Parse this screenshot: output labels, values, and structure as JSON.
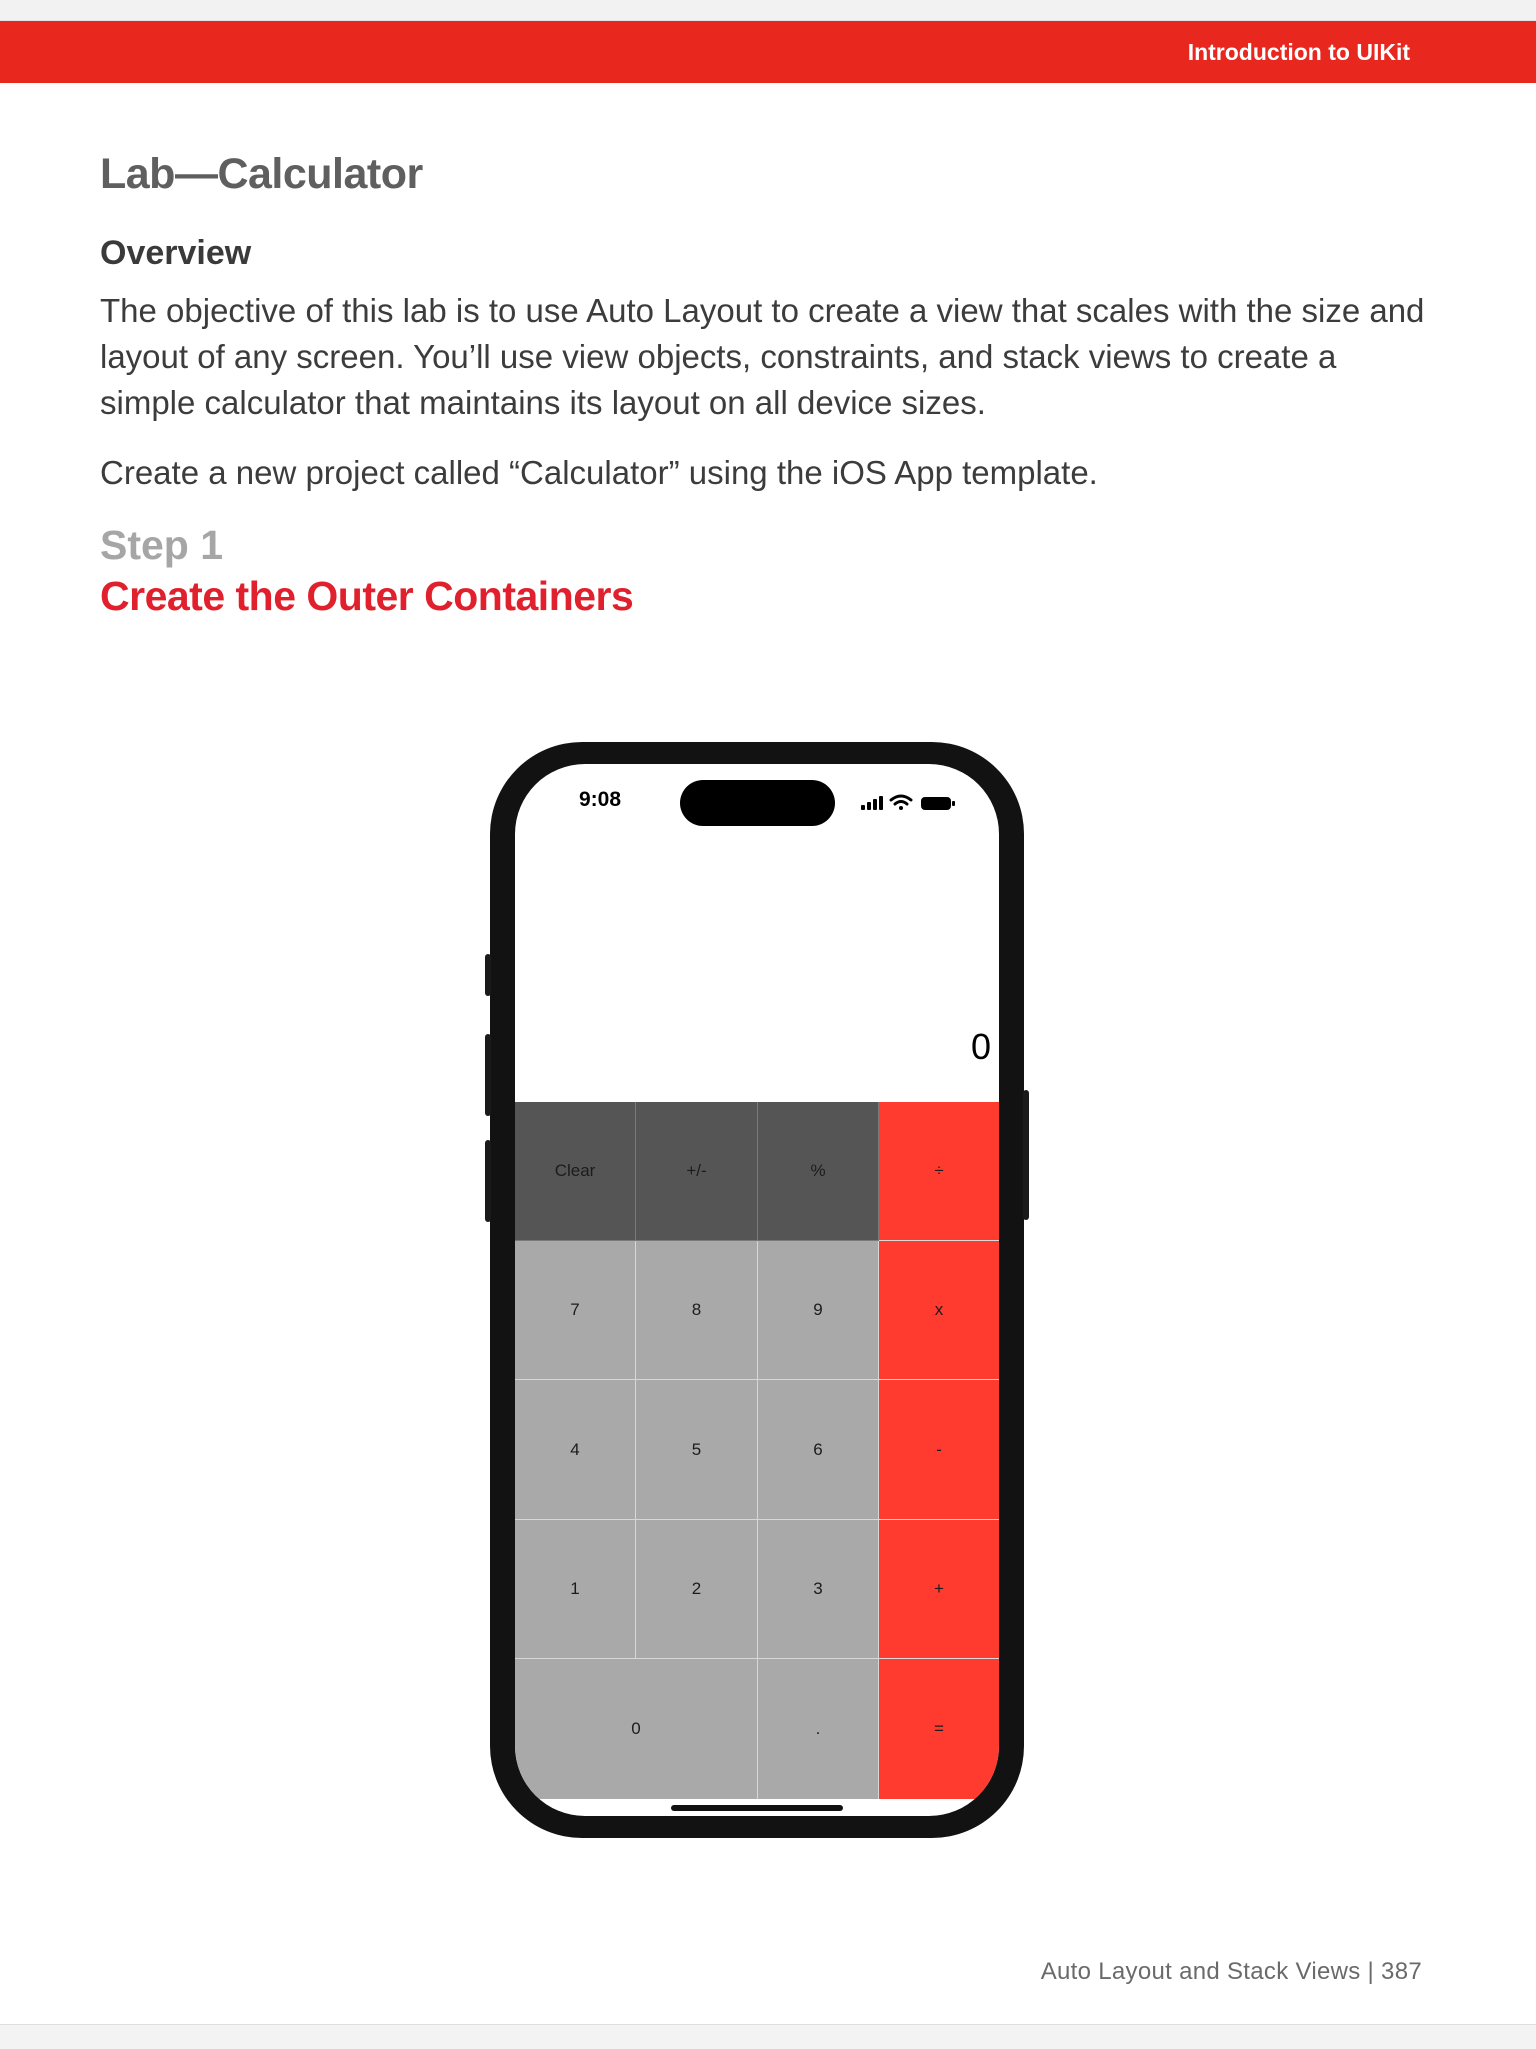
{
  "header": {
    "title": "Introduction to UIKit",
    "color": "#e8271f"
  },
  "lab_title": "Lab—Calculator",
  "overview": {
    "heading": "Overview",
    "text": "The objective of this lab is to use Auto Layout to create a view that scales with the size and layout of any screen. You’ll use view objects, constraints, and  stack views to create a simple calculator that maintains its layout on all device sizes."
  },
  "create_text": "Create a new project called “Calculator” using the iOS App template.",
  "step": {
    "label": "Step 1",
    "title": "Create the Outer Containers",
    "title_color": "#e0202c"
  },
  "phone": {
    "status_time": "9:08",
    "status_icons": [
      "signal-icon",
      "wifi-icon",
      "battery-icon"
    ],
    "display_value": "0",
    "colors": {
      "function_key": "#555555",
      "number_key": "#a9a9a9",
      "operator_key": "#ff3b30"
    },
    "keys": {
      "clear": "Clear",
      "sign": "+/-",
      "percent": "%",
      "divide": "÷",
      "seven": "7",
      "eight": "8",
      "nine": "9",
      "multiply": "x",
      "four": "4",
      "five": "5",
      "six": "6",
      "minus": "-",
      "one": "1",
      "two": "2",
      "three": "3",
      "plus": "+",
      "zero": "0",
      "decimal": ".",
      "equals": "="
    }
  },
  "footer": {
    "text": "Auto Layout and Stack Views  |  387"
  }
}
